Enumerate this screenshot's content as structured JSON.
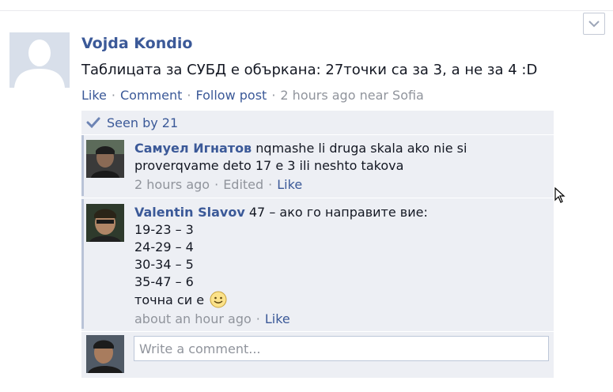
{
  "post": {
    "author": "Vojda Kondio",
    "message": "Таблицата за СУБД е объркана: 27точки са за 3, а не за 4 :D",
    "actions": {
      "like": "Like",
      "comment": "Comment",
      "follow": "Follow post",
      "time": "2 hours ago near Sofia"
    }
  },
  "seen": {
    "label": "Seen by 21"
  },
  "comments": [
    {
      "author": "Самуел Игнатов",
      "text_line1": "nqmashe li druga skala ako nie si",
      "text_line2": "proverqvame deto 17 e 3 ili neshto takova",
      "time": "2 hours ago",
      "edited": "Edited",
      "like": "Like"
    },
    {
      "author": "Valentin Slavov",
      "text_line1": "47 – ако го направите вие:",
      "line2": "19-23 – 3",
      "line3": "24-29 – 4",
      "line4": "30-34 – 5",
      "line5": "35-47 – 6",
      "line6": "точна си е",
      "time": "about an hour ago",
      "like": "Like"
    }
  ],
  "composer": {
    "placeholder": "Write a comment..."
  },
  "colors": {
    "link": "#3b5998",
    "meta": "#90949c",
    "panel": "#edeff4"
  },
  "icons": [
    "chevron-down-icon",
    "checkmark-icon",
    "smiley-icon",
    "mouse-cursor-icon"
  ]
}
